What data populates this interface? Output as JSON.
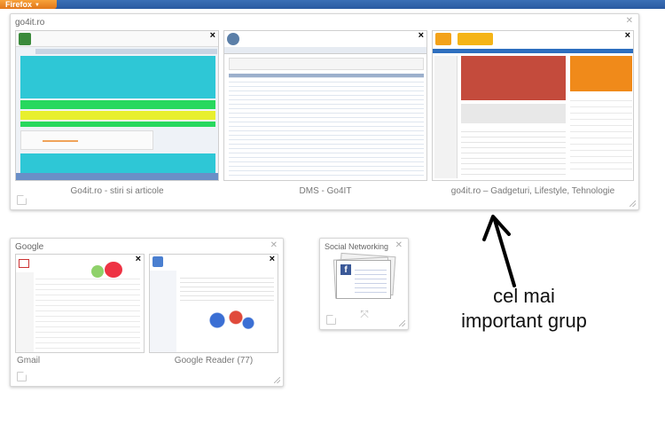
{
  "window": {
    "app_button_label": "Firefox",
    "accent_color": "#e1771a"
  },
  "groups": [
    {
      "title": "go4it.ro",
      "tabs": [
        {
          "label": "Go4it.ro - stiri si articole"
        },
        {
          "label": "DMS - Go4IT"
        },
        {
          "label": "go4it.ro – Gadgeturi, Lifestyle, Tehnologie"
        }
      ]
    },
    {
      "title": "Google",
      "tabs": [
        {
          "label": "Gmail"
        },
        {
          "label": "Google Reader (77)"
        }
      ]
    },
    {
      "title": "Social Networking",
      "tabs": []
    }
  ],
  "annotation": {
    "line1": "cel mai",
    "line2": "important grup"
  },
  "icons": {
    "group_close": "close-icon",
    "tab_close": "close-icon",
    "new_tab": "new-tab-icon",
    "resize": "resize-grip-icon"
  }
}
